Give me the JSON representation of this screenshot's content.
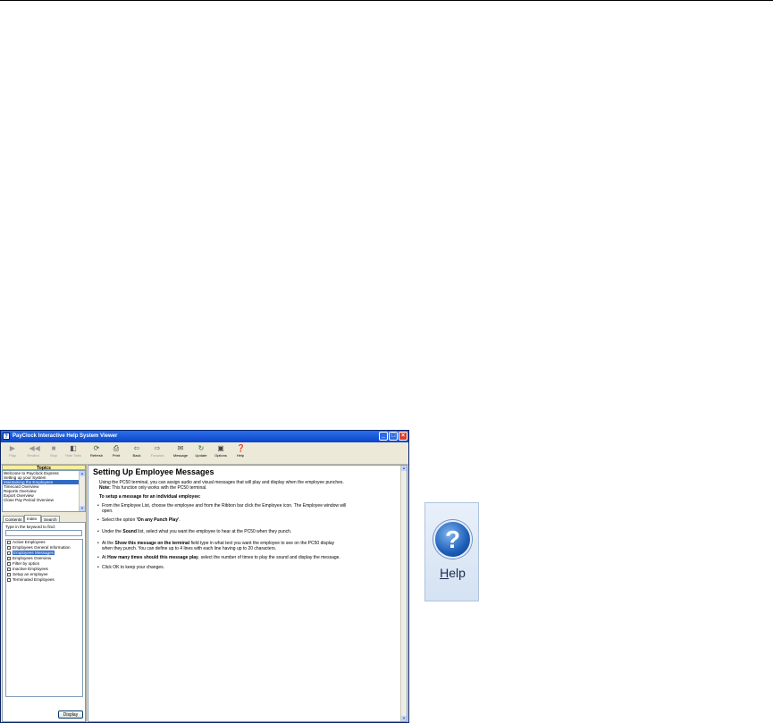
{
  "window": {
    "title": "PayClock Interactive Help System Viewer",
    "app_icon": "?",
    "min_glyph": "_",
    "max_glyph": "□",
    "close_glyph": "×"
  },
  "toolbar": {
    "left_tools": [
      {
        "label": "Play",
        "icon": "play-icon"
      },
      {
        "label": "Rewind",
        "icon": "rewind-icon"
      },
      {
        "label": "Stop",
        "icon": "stop-icon"
      },
      {
        "label": "Hide Tabs",
        "icon": "hide-tabs-icon"
      }
    ],
    "right_tools": [
      {
        "label": "Refresh",
        "icon": "refresh-icon"
      },
      {
        "label": "Print",
        "icon": "print-icon"
      },
      {
        "label": "Back",
        "icon": "back-icon"
      },
      {
        "label": "Forward",
        "icon": "forward-icon"
      },
      {
        "label": "Message",
        "icon": "message-icon"
      },
      {
        "label": "Update",
        "icon": "update-icon"
      },
      {
        "label": "Options",
        "icon": "options-icon"
      },
      {
        "label": "Help",
        "icon": "help-icon"
      }
    ]
  },
  "topics": {
    "header": "Topics",
    "items": [
      "Welcome to Payclock Express",
      "Setting up your System",
      "Maintaining the Employees",
      "Timecard Overview",
      "Reports Overview",
      "Export Overview",
      "Close Pay Period Overview"
    ],
    "selected_index": 2
  },
  "tabs": [
    "Contents",
    "Index",
    "Search"
  ],
  "active_tab": "Index",
  "index": {
    "keyword_label": "Type in the keyword to find:",
    "keyword_value": "",
    "items": [
      "Active Employees",
      "Employees General Information",
      "Employees Messages",
      "Employees Overview",
      "Filter by option",
      "Inactive Employees",
      "Setup an employee",
      "Terminated Employees"
    ],
    "selected_index": 2,
    "display_button": "Display"
  },
  "content": {
    "title": "Setting Up Employee Messages",
    "intro": "Using the PC50 terminal, you can assign audio and visual messages that will play and display when the employee punches.",
    "note_label": "Note:",
    "note_text": " This function only works with the PC50 terminal.",
    "subheading": "To setup a message for an individual employee:",
    "steps": [
      {
        "line1": "From the Employee List, choose the employee and from the Ribbon bar click the Employee icon. The Employee window will",
        "line2": "open."
      },
      {
        "pre": "Select the option ",
        "bold": "'On any Punch Play'",
        "post": "."
      },
      {
        "pre": "Under the ",
        "bold": "Sound",
        "post": " list, select what you want the employee to hear at the PC50 when they punch."
      },
      {
        "pre": "At the ",
        "bold": "Show this message on the terminal",
        "post": " field type in what text you want the employee to see on the PC50 display",
        "line2": "when they punch. You can define up to 4 lines with each line having up to 20 characters."
      },
      {
        "pre": "At ",
        "bold": "How many times should this message play",
        "post": ", select the number of times to play the sound and display the message."
      },
      {
        "pre": "Click OK to keep your changes.",
        "bold": "",
        "post": ""
      }
    ]
  },
  "help_ribbon": {
    "glyph": "?",
    "label_underlined": "H",
    "label_rest": "elp",
    "accent": "#1D5EB8"
  },
  "colors": {
    "titlebar": "#0A44C9",
    "selection": "#316AC5",
    "topics_header": "#F6EFA0"
  }
}
